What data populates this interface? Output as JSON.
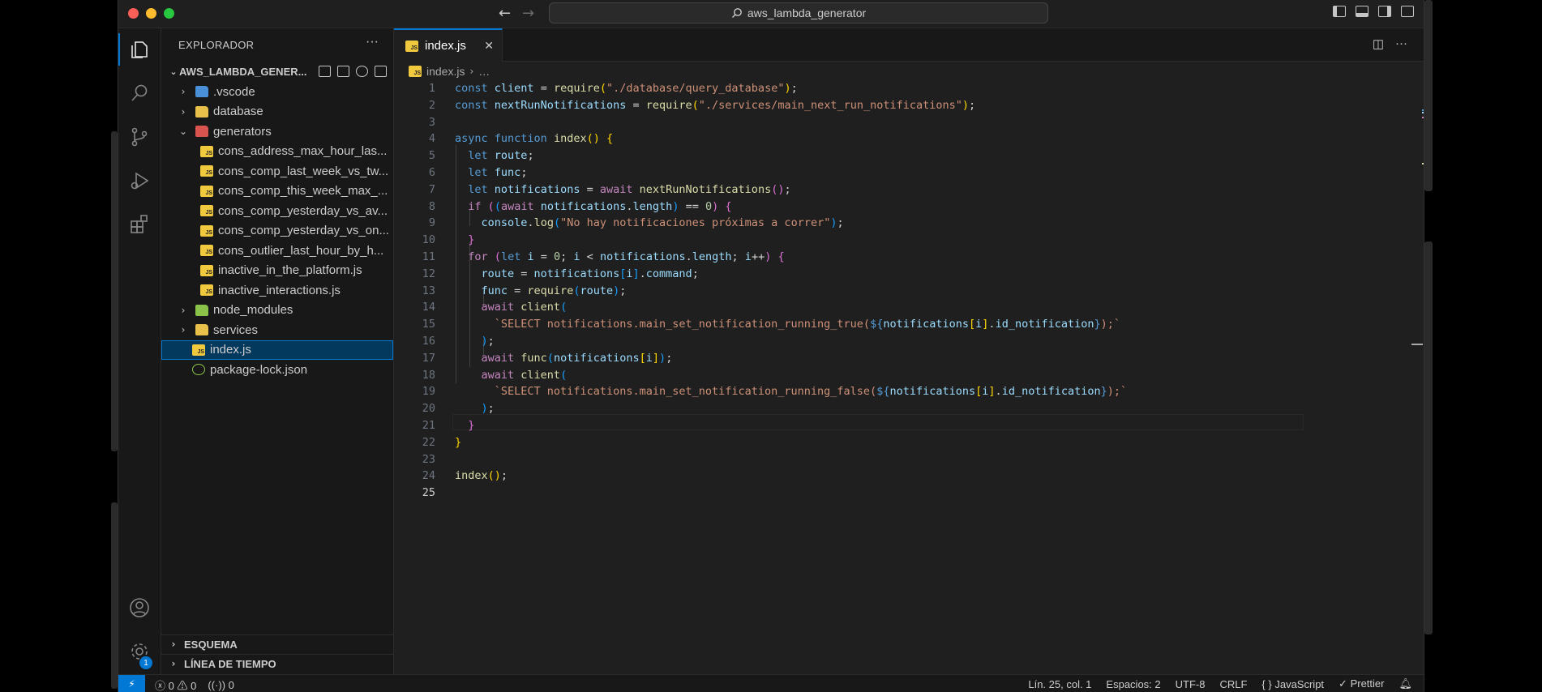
{
  "window": {
    "title": "aws_lambda_generator",
    "traffic_colors": [
      "#ff5f57",
      "#febc2e",
      "#28c840"
    ]
  },
  "explorer": {
    "title": "EXPLORADOR",
    "more": "···",
    "root": "AWS_LAMBDA_GENER...",
    "items": [
      {
        "label": ".vscode",
        "kind": "folder",
        "color": "#4a90d9",
        "chev": "›",
        "indent": 20
      },
      {
        "label": "database",
        "kind": "folder",
        "color": "#e8c04a",
        "chev": "›",
        "indent": 20
      },
      {
        "label": "generators",
        "kind": "folder",
        "color": "#d9534f",
        "chev": "⌄",
        "indent": 20
      },
      {
        "label": "cons_address_max_hour_las...",
        "kind": "js",
        "indent": 48
      },
      {
        "label": "cons_comp_last_week_vs_tw...",
        "kind": "js",
        "indent": 48
      },
      {
        "label": "cons_comp_this_week_max_...",
        "kind": "js",
        "indent": 48
      },
      {
        "label": "cons_comp_yesterday_vs_av...",
        "kind": "js",
        "indent": 48
      },
      {
        "label": "cons_comp_yesterday_vs_on...",
        "kind": "js",
        "indent": 48
      },
      {
        "label": "cons_outlier_last_hour_by_h...",
        "kind": "js",
        "indent": 48
      },
      {
        "label": "inactive_in_the_platform.js",
        "kind": "js",
        "indent": 48
      },
      {
        "label": "inactive_interactions.js",
        "kind": "js",
        "indent": 48
      },
      {
        "label": "node_modules",
        "kind": "folder",
        "color": "#8bc34a",
        "chev": "›",
        "indent": 20
      },
      {
        "label": "services",
        "kind": "folder",
        "color": "#e8c04a",
        "chev": "›",
        "indent": 20
      },
      {
        "label": "index.js",
        "kind": "js",
        "indent": 38,
        "selected": true
      },
      {
        "label": "package-lock.json",
        "kind": "json",
        "indent": 38
      }
    ],
    "sections": [
      "ESQUEMA",
      "LÍNEA DE TIEMPO"
    ]
  },
  "editor": {
    "tab": "index.js",
    "breadcrumb_file": "index.js",
    "breadcrumb_rest": "…",
    "current_line": 25
  },
  "status": {
    "remote": "⚡",
    "errors": "0",
    "warnings": "0",
    "ports": "0",
    "position": "Lín. 25, col. 1",
    "spaces": "Espacios: 2",
    "encoding": "UTF-8",
    "eol": "CRLF",
    "language": "JavaScript",
    "formatter": "Prettier"
  },
  "activity_badge": "1"
}
